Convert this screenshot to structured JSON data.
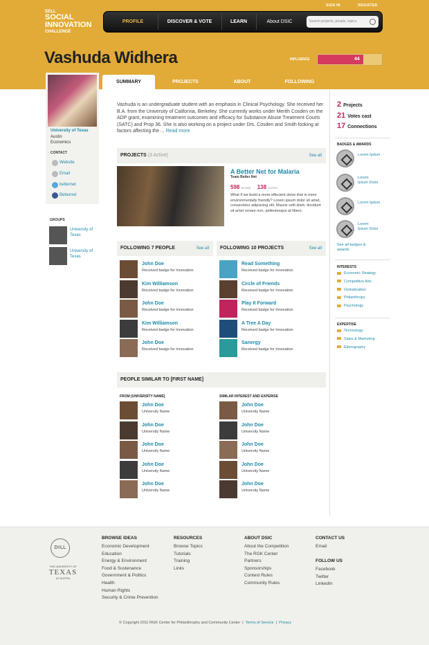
{
  "header": {
    "logo": {
      "line1": "DELL",
      "line2": "SOCIAL INNOVATION",
      "line3": "CHALLENGE"
    },
    "top_links": [
      "SIGN IN",
      "REGISTER"
    ],
    "nav": [
      "PROFILE",
      "DISCOVER & VOTE",
      "LEARN",
      "About DSIC"
    ],
    "search_placeholder": "Search projects, people, topics",
    "colors": {
      "brand": "#e2ab37",
      "accent": "#c0245c",
      "link": "#1e8aa8"
    }
  },
  "profile": {
    "name": "Vashuda Widhera",
    "influence_label": "INFLUENCE",
    "influence_value": "44",
    "influence_fraction": 0.7
  },
  "tabs": [
    "SUMMARY",
    "PROJECTS",
    "ABOUT",
    "FOLLOWING"
  ],
  "left": {
    "school": "University of Texas",
    "city": "Austin",
    "field": "Economics",
    "contact_heading": "CONTACT",
    "contacts": [
      {
        "label": "Website",
        "icon": "globe-icon"
      },
      {
        "label": "Email",
        "icon": "mail-icon"
      },
      {
        "label": "betternet",
        "icon": "skype-icon"
      },
      {
        "label": "Betternet",
        "icon": "facebook-icon"
      }
    ],
    "groups_heading": "GROUPS",
    "groups": [
      {
        "line1": "University of",
        "line2": "Texas"
      },
      {
        "line1": "University of",
        "line2": "Texas"
      }
    ]
  },
  "summary": {
    "text": "Vashuda is an undergraduate student with an emphasis in Clinical Psychology. She received her B.A. from the University of California, Berkeley.  She currently works under Merith Cosden on the ADP grant, examining treatment outcomes and efficacy for Substance Abuse Treatment Courts (SATC) and Prop 36.  She is also working on a project under Drs. Cosden and Smith looking at factors affecting the ...",
    "more": "Read more"
  },
  "projects": {
    "heading": "PROJECTS",
    "sub": "(3 Active)",
    "see_all": "See all",
    "featured": {
      "title": "A Better Net for Malaria",
      "team": "Team Better Net",
      "score": "598",
      "score_label": "SCORE",
      "votes": "138",
      "votes_label": "VOTES",
      "desc": "What if we build a more effecient stove that is more environmentally friendly? Lorem ipsum dolor sit amet, consectetur adipiscing elit. Mauris velit diam, tincidunt sit amet ornare non, pellentesque at libero."
    }
  },
  "following_people": {
    "heading": "FOLLOWING 7 PEOPLE",
    "see_all": "See all",
    "items": [
      {
        "name": "John Doe",
        "sub": "Received badge for Innovation"
      },
      {
        "name": "Kim Williamson",
        "sub": "Received badge for Innovation"
      },
      {
        "name": "John Doe",
        "sub": "Received badge for Innovation"
      },
      {
        "name": "Kim Williamson",
        "sub": "Received badge for Innovation"
      },
      {
        "name": "John Doe",
        "sub": "Received badge for Innovation"
      }
    ]
  },
  "following_projects": {
    "heading": "FOLLOWING 10 PROJECTS",
    "see_all": "See all",
    "items": [
      {
        "name": "Read Something",
        "sub": "Received badge for Innovation"
      },
      {
        "name": "Circle of Friends",
        "sub": "Received badge for Innovation"
      },
      {
        "name": "Play It Forward",
        "sub": "Received badge for Innovation"
      },
      {
        "name": "A Tree A Day",
        "sub": "Received badge for Innovation"
      },
      {
        "name": "Sanergy",
        "sub": "Received badge for Innovation"
      }
    ]
  },
  "similar": {
    "heading": "PEOPLE SIMILAR TO [FIRST NAME]",
    "col1_heading": "FROM [UNIVERSITY NAME]",
    "col2_heading": "SIMILAR INTEREST AND EXPERISE",
    "col1": [
      {
        "name": "John Doe",
        "sub": "University Name"
      },
      {
        "name": "John Doe",
        "sub": "University Name"
      },
      {
        "name": "John Doe",
        "sub": "University Name"
      },
      {
        "name": "John Doe",
        "sub": "University Name"
      },
      {
        "name": "John Doe",
        "sub": "University Name"
      }
    ],
    "col2": [
      {
        "name": "John Doe",
        "sub": "University Name"
      },
      {
        "name": "John Doe",
        "sub": "University Name"
      },
      {
        "name": "John Doe",
        "sub": "University Name"
      },
      {
        "name": "John Doe",
        "sub": "University Name"
      },
      {
        "name": "John Doe",
        "sub": "University Name"
      }
    ]
  },
  "right": {
    "stats": [
      {
        "num": "2",
        "label": "Projects"
      },
      {
        "num": "21",
        "label": "Votes cast"
      },
      {
        "num": "17",
        "label": "Connections"
      }
    ],
    "badges_heading": "BADGES & AWARDS",
    "badges": [
      {
        "line1": "Lorem Ipdum",
        "line2": ""
      },
      {
        "line1": "Lorem",
        "line2": "Ipsum Dolor"
      },
      {
        "line1": "Lorem Ipdum",
        "line2": ""
      },
      {
        "line1": "Lorem",
        "line2": "Ipsum Dolor"
      }
    ],
    "see_all_badges_1": "See all badges &",
    "see_all_badges_2": "awards",
    "interests_heading": "INTERESTS",
    "interests": [
      "Economic Strategy",
      "Competitive Adv.",
      "Globalization",
      "Philanthropy",
      "Psychology"
    ],
    "expertise_heading": "EXPERTISE",
    "expertise": [
      "Technology",
      "Sales & Marketing",
      "Ethnography"
    ]
  },
  "footer": {
    "dell": "D◊LL",
    "ut_line1": "THE UNIVERSITY OF",
    "ut_line2": "TEXAS",
    "ut_line3": "AT AUSTIN",
    "cols": [
      {
        "heading": "BROWSE IDEAS",
        "items": [
          "Economic Development",
          "Education",
          "Energy & Environment",
          "Food & Sustenance",
          "Government & Politics",
          "Health",
          "Human Rights",
          "Security & Crime Prevention"
        ]
      },
      {
        "heading": "RESOURCES",
        "items": [
          "Browse Topics",
          "Tutorials",
          "Training",
          "Links"
        ]
      },
      {
        "heading": "ABOUT DSIC",
        "items": [
          "About the Competition",
          "The RGK Center",
          "Partners",
          "Sponsorships",
          "Contest Rules",
          "Community Rules"
        ]
      },
      {
        "heading": "CONTACT US",
        "items": [
          "Email"
        ]
      },
      {
        "heading": "FOLLOW US",
        "items": [
          "Facebook",
          "Twitter",
          "LinkedIn"
        ]
      }
    ],
    "copyright": "© Copyright 2011 RGK Center for Philanthrophy and Community Center",
    "sep": "|",
    "terms": "Terms of Service",
    "privacy": "Privacy"
  }
}
